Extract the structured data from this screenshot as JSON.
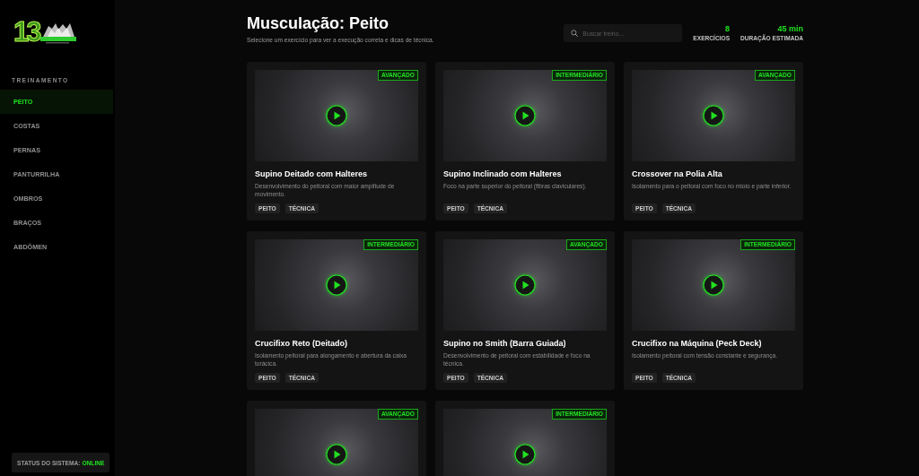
{
  "sidebar": {
    "logo": {
      "text": "13"
    },
    "section_label": "TREINAMENTO",
    "items": [
      {
        "label": "PEITO",
        "selected": true
      },
      {
        "label": "COSTAS",
        "selected": false
      },
      {
        "label": "PERNAS",
        "selected": false
      },
      {
        "label": "PANTURRILHA",
        "selected": false
      },
      {
        "label": "OMBROS",
        "selected": false
      },
      {
        "label": "BRAÇOS",
        "selected": false
      },
      {
        "label": "ABDÔMEN",
        "selected": false
      }
    ],
    "status": {
      "label": "STATUS DO SISTEMA:",
      "value": "ONLINE"
    }
  },
  "header": {
    "title": "Musculação: Peito",
    "subtitle": "Selecione um exercício para ver a execução correta e dicas de técnica.",
    "search": {
      "placeholder": "Buscar treino..."
    },
    "stats": [
      {
        "value": "8",
        "label": "EXERCÍCIOS"
      },
      {
        "value": "45 min",
        "label": "DURAÇÃO ESTIMADA"
      }
    ]
  },
  "exercises": [
    {
      "badge": "AVANÇADO",
      "title": "Supino Deitado com Halteres",
      "description": "Desenvolvimento do peitoral com maior amplitude de movimento.",
      "tags": [
        "PEITO",
        "TÉCNICA"
      ]
    },
    {
      "badge": "INTERMEDIÁRIO",
      "title": "Supino Inclinado com Halteres",
      "description": "Foco na parte superior do peitoral (fibras claviculares).",
      "tags": [
        "PEITO",
        "TÉCNICA"
      ]
    },
    {
      "badge": "AVANÇADO",
      "title": "Crossover na Polia Alta",
      "description": "Isolamento para o peitoral com foco no miolo e parte inferior.",
      "tags": [
        "PEITO",
        "TÉCNICA"
      ]
    },
    {
      "badge": "INTERMEDIÁRIO",
      "title": "Crucifixo Reto (Deitado)",
      "description": "Isolamento peitoral para alongamento e abertura da caixa torácica.",
      "tags": [
        "PEITO",
        "TÉCNICA"
      ]
    },
    {
      "badge": "AVANÇADO",
      "title": "Supino no Smith (Barra Guiada)",
      "description": "Desenvolvimento de peitoral com estabilidade e foco na técnica.",
      "tags": [
        "PEITO",
        "TÉCNICA"
      ]
    },
    {
      "badge": "INTERMEDIÁRIO",
      "title": "Crucifixo na Máquina (Peck Deck)",
      "description": "Isolamento peitoral com tensão constante e segurança.",
      "tags": [
        "PEITO",
        "TÉCNICA"
      ]
    },
    {
      "badge": "AVANÇADO"
    },
    {
      "badge": "INTERMEDIÁRIO"
    }
  ]
}
